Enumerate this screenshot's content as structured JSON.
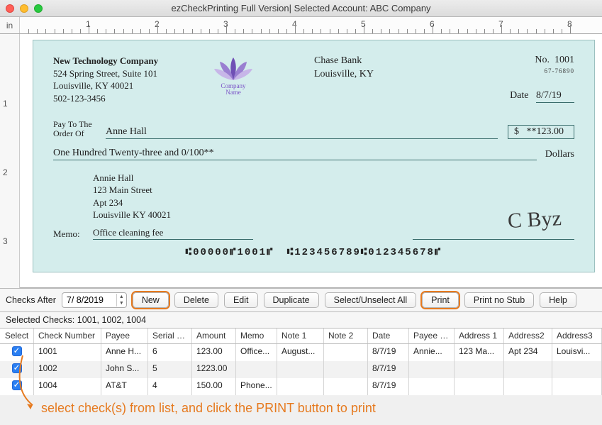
{
  "window": {
    "title": "ezCheckPrinting Full Version| Selected Account: ABC Company"
  },
  "ruler": {
    "unit": "in",
    "marks": [
      "1",
      "2",
      "3",
      "4",
      "5",
      "6",
      "7",
      "8"
    ],
    "vmarks": [
      "1",
      "2",
      "3"
    ]
  },
  "check": {
    "company": {
      "name": "New Technology Company",
      "addr1": "524 Spring Street, Suite 101",
      "addr2": "Louisville, KY 40021",
      "phone": "502-123-3456"
    },
    "logo": {
      "line1": "Company",
      "line2": "Name"
    },
    "bank": {
      "name": "Chase Bank",
      "city": "Louisville, KY"
    },
    "number_label": "No.",
    "number": "1001",
    "routing_small": "67-76890",
    "date_label": "Date",
    "date": "8/7/19",
    "payto_label1": "Pay To The",
    "payto_label2": "Order Of",
    "payee": "Anne Hall",
    "amount_symbol": "$",
    "amount": "**123.00",
    "amount_words": "One Hundred Twenty-three and 0/100**",
    "dollars_label": "Dollars",
    "addr": {
      "name": "Annie Hall",
      "l1": "123 Main Street",
      "l2": "Apt 234",
      "l3": "Louisville KY 40021"
    },
    "memo_label": "Memo:",
    "memo": "Office cleaning fee",
    "micr": "⑆00000⑈1001⑈ ⑆123456789⑆012345678⑈",
    "signature": "C Byz"
  },
  "toolbar": {
    "checks_after_label": "Checks After",
    "date": "7/ 8/2019",
    "new": "New",
    "delete": "Delete",
    "edit": "Edit",
    "duplicate": "Duplicate",
    "select_all": "Select/Unselect All",
    "print": "Print",
    "print_nostub": "Print no Stub",
    "help": "Help"
  },
  "selected_header": "Selected Checks: 1001, 1002, 1004",
  "table": {
    "headers": {
      "select": "Select",
      "num": "Check Number",
      "payee": "Payee",
      "serial": "Serial N...",
      "amount": "Amount",
      "memo": "Memo",
      "n1": "Note 1",
      "n2": "Note 2",
      "date": "Date",
      "pn": "Payee N...",
      "a1": "Address 1",
      "a2": "Address2",
      "a3": "Address3"
    },
    "rows": [
      {
        "sel": true,
        "num": "1001",
        "payee": "Anne H...",
        "serial": "6",
        "amount": "123.00",
        "memo": "Office...",
        "n1": "August...",
        "n2": "",
        "date": "8/7/19",
        "pn": "Annie...",
        "a1": "123 Ma...",
        "a2": "Apt 234",
        "a3": "Louisvi..."
      },
      {
        "sel": true,
        "num": "1002",
        "payee": "John S...",
        "serial": "5",
        "amount": "1223.00",
        "memo": "",
        "n1": "",
        "n2": "",
        "date": "8/7/19",
        "pn": "",
        "a1": "",
        "a2": "",
        "a3": ""
      },
      {
        "sel": true,
        "num": "1004",
        "payee": "AT&T",
        "serial": "4",
        "amount": "150.00",
        "memo": "Phone...",
        "n1": "",
        "n2": "",
        "date": "8/7/19",
        "pn": "",
        "a1": "",
        "a2": "",
        "a3": ""
      }
    ]
  },
  "hint": "select check(s) from list, and click the PRINT button to print"
}
